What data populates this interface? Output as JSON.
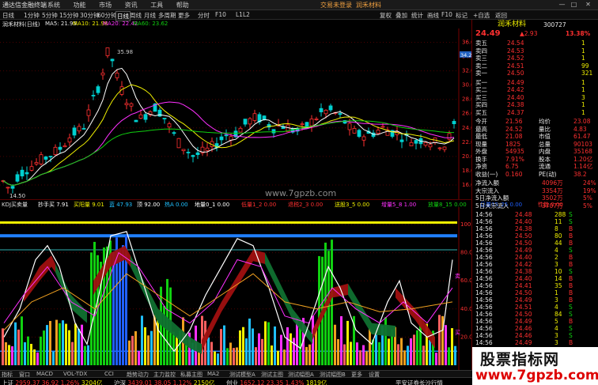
{
  "titlebar": {
    "app_name": "通达信金融终端",
    "menus": [
      "系统",
      "功能",
      "市场",
      "资讯",
      "工具",
      "帮助"
    ],
    "notice_a": "交易未登录",
    "notice_b": "润禾材料"
  },
  "menubar": {
    "items": [
      "日线",
      "1分钟",
      "5分钟",
      "15分钟",
      "30分钟",
      "60分钟",
      "日线",
      "周线",
      "月线",
      "多周期",
      "更多",
      "分时",
      "F10",
      "L1L2"
    ],
    "right_items": [
      "复权",
      "叠加",
      "统计",
      "画线",
      "F10",
      "标记",
      "+自选",
      "返回"
    ]
  },
  "chart": {
    "stock_title": "润禾材料(日线)",
    "ma5_label": "MA5: 21.95",
    "ma10_label": "MA10: 21.98",
    "ma20_label": "MA20: 22.42",
    "ma60_label": "MA60: 23.62",
    "high_marker": "35.98",
    "low_marker": "14.50",
    "price_axis": [
      "36.00",
      "34.00",
      "32.00",
      "30.00",
      "28.00",
      "26.00",
      "24.00",
      "22.00",
      "20.00",
      "18.00",
      "16.00"
    ],
    "current_price_tag": "34.28",
    "watermark": "www.7gpzb.com"
  },
  "indicator": {
    "title": "KDJ买卖量",
    "fields": [
      {
        "label": "抄手买",
        "value": "7.91",
        "color": "#ffffff"
      },
      {
        "label": "买阳量",
        "value": "9.01",
        "color": "#f0f000"
      },
      {
        "label": "蓝",
        "value": "47.93",
        "color": "#20c0ff"
      },
      {
        "label": "顶",
        "value": "92.00",
        "color": "#ffffff"
      },
      {
        "label": "热A",
        "value": "0.00",
        "color": "#20c0ff"
      },
      {
        "label": "地量0_1",
        "value": "0.00",
        "color": "#ffffff"
      },
      {
        "label": "低量1_2",
        "value": "0.00",
        "color": "#ff3030"
      },
      {
        "label": "退税2_3",
        "value": "0.00",
        "color": "#ff3030"
      },
      {
        "label": "送股3_5",
        "value": "0.00",
        "color": "#f0f000"
      },
      {
        "label": "增量5_8",
        "value": "1.00",
        "color": "#ff30ff"
      },
      {
        "label": "放量8_15",
        "value": "0.00",
        "color": "#10d010"
      },
      {
        "label": "巨量15_25",
        "value": "0.00",
        "color": "#2060ff"
      },
      {
        "label": "性能",
        "value": "0.00",
        "color": "#ff3030"
      }
    ],
    "axis": [
      "100.00",
      "80.00",
      "60.00",
      "40.00",
      "20.00"
    ],
    "marker_top": "卖",
    "marker_low": "买"
  },
  "quote": {
    "code_title": "润禾材料",
    "code": "300727",
    "price": "24.49",
    "change": "2.93",
    "change_pct": "13.38%",
    "asks": [
      {
        "label": "卖五",
        "price": "24.54",
        "vol": "1"
      },
      {
        "label": "卖四",
        "price": "24.53",
        "vol": "1"
      },
      {
        "label": "卖三",
        "price": "24.52",
        "vol": "1"
      },
      {
        "label": "卖二",
        "price": "24.51",
        "vol": "99"
      },
      {
        "label": "卖一",
        "price": "24.50",
        "vol": "321"
      }
    ],
    "bids": [
      {
        "label": "买一",
        "price": "24.49",
        "vol": "1"
      },
      {
        "label": "买二",
        "price": "24.42",
        "vol": "1"
      },
      {
        "label": "买三",
        "price": "24.40",
        "vol": "3"
      },
      {
        "label": "买四",
        "price": "24.38",
        "vol": "1"
      },
      {
        "label": "买五",
        "price": "24.37",
        "vol": "1"
      }
    ],
    "stats": [
      {
        "l1": "今开",
        "v1": "21.56",
        "l2": "均价",
        "v2": "23.08"
      },
      {
        "l1": "最高",
        "v1": "24.52",
        "l2": "量比",
        "v2": "4.83"
      },
      {
        "l1": "最低",
        "v1": "21.08",
        "l2": "市值",
        "v2": "61.47"
      },
      {
        "l1": "现量",
        "v1": "1825",
        "l2": "总量",
        "v2": "90103"
      },
      {
        "l1": "外盘",
        "v1": "54935",
        "l2": "内盘",
        "v2": "35168"
      },
      {
        "l1": "换手",
        "v1": "7.91%",
        "l2": "股本",
        "v2": "1.20亿"
      },
      {
        "l1": "净资",
        "v1": "6.75",
        "l2": "流通",
        "v2": "1.14亿"
      },
      {
        "l1": "收益(一)",
        "v1": "0.160",
        "l2": "PE(动)",
        "v2": "38.2"
      }
    ],
    "flows": [
      {
        "label": "净流入额",
        "value": "4096万",
        "pct": "24%"
      },
      {
        "label": "大宗流入",
        "value": "3354万",
        "pct": "19%"
      },
      {
        "label": "5日净流入额",
        "value": "3502万",
        "pct": "5%"
      },
      {
        "label": "5日大宗流入",
        "value": "3707万",
        "pct": "5%"
      }
    ],
    "ticks": [
      {
        "t": "14:56",
        "p": "24.48",
        "v": "288",
        "s": "S"
      },
      {
        "t": "14:56",
        "p": "24.40",
        "v": "11",
        "s": "S"
      },
      {
        "t": "14:56",
        "p": "24.38",
        "v": "8",
        "s": "B"
      },
      {
        "t": "14:56",
        "p": "24.50",
        "v": "80",
        "s": "B"
      },
      {
        "t": "14:56",
        "p": "24.50",
        "v": "44",
        "s": "B"
      },
      {
        "t": "14:56",
        "p": "24.49",
        "v": "4",
        "s": "S"
      },
      {
        "t": "14:56",
        "p": "24.40",
        "v": "2",
        "s": "B"
      },
      {
        "t": "14:56",
        "p": "24.42",
        "v": "3",
        "s": "B"
      },
      {
        "t": "14:56",
        "p": "24.38",
        "v": "10",
        "s": "S"
      },
      {
        "t": "14:56",
        "p": "24.40",
        "v": "14",
        "s": "B"
      },
      {
        "t": "14:56",
        "p": "24.41",
        "v": "35",
        "s": "B"
      },
      {
        "t": "14:56",
        "p": "24.50",
        "v": "1",
        "s": "B"
      },
      {
        "t": "14:56",
        "p": "24.49",
        "v": "3",
        "s": "B"
      },
      {
        "t": "14:56",
        "p": "24.51",
        "v": "4",
        "s": "S"
      },
      {
        "t": "14:56",
        "p": "24.50",
        "v": "84",
        "s": "S"
      },
      {
        "t": "14:56",
        "p": "24.49",
        "v": "5",
        "s": "B"
      },
      {
        "t": "14:56",
        "p": "24.46",
        "v": "4",
        "s": "S"
      },
      {
        "t": "14:56",
        "p": "24.46",
        "v": "3",
        "s": "S"
      },
      {
        "t": "14:56",
        "p": "24.49",
        "v": "3",
        "s": "B"
      },
      {
        "t": "14:57",
        "p": "24.49",
        "v": "1825",
        "s": "B"
      }
    ]
  },
  "bottom_tabs": [
    "指标",
    "窗口",
    "MACD",
    "VOL-TDX",
    "CCI",
    "趋势动力",
    "主力监控",
    "私募主图",
    "MA2",
    "测试模型A",
    "测试主图",
    "测试幅图A",
    "测试幅图B",
    "更多",
    "设置"
  ],
  "bottom_tabs2": [
    "扩展A",
    "关联报价",
    "资金分布",
    "综合资讯",
    "行业资讯",
    "互动问答",
    "普及股文配说明"
  ],
  "date_labels": [
    "2024年",
    "2024/02/20(二)",
    "2",
    "3",
    "4",
    "5",
    "6",
    "7"
  ],
  "status": {
    "items": [
      {
        "name": "上证",
        "val": "2959.37",
        "chg": "36.92",
        "pct": "1.26%",
        "amt": "3204亿"
      },
      {
        "name": "沪深",
        "val": "3439.01",
        "chg": "38.05",
        "pct": "1.12%",
        "amt": "2150亿"
      },
      {
        "name": "创业",
        "val": "1652.12",
        "chg": "23.35",
        "pct": "1.43%",
        "amt": "1819亿"
      }
    ],
    "right_text": "平安证券长沙行情"
  },
  "watermark_box": {
    "line1": "股票指标网",
    "line2": "www.7gpzb.com"
  },
  "colors": {
    "up": "#ff3030",
    "down": "#00d0d0",
    "ma5": "#ffffff",
    "ma10": "#f0f000",
    "ma20": "#ff30ff",
    "ma60": "#10d010"
  }
}
